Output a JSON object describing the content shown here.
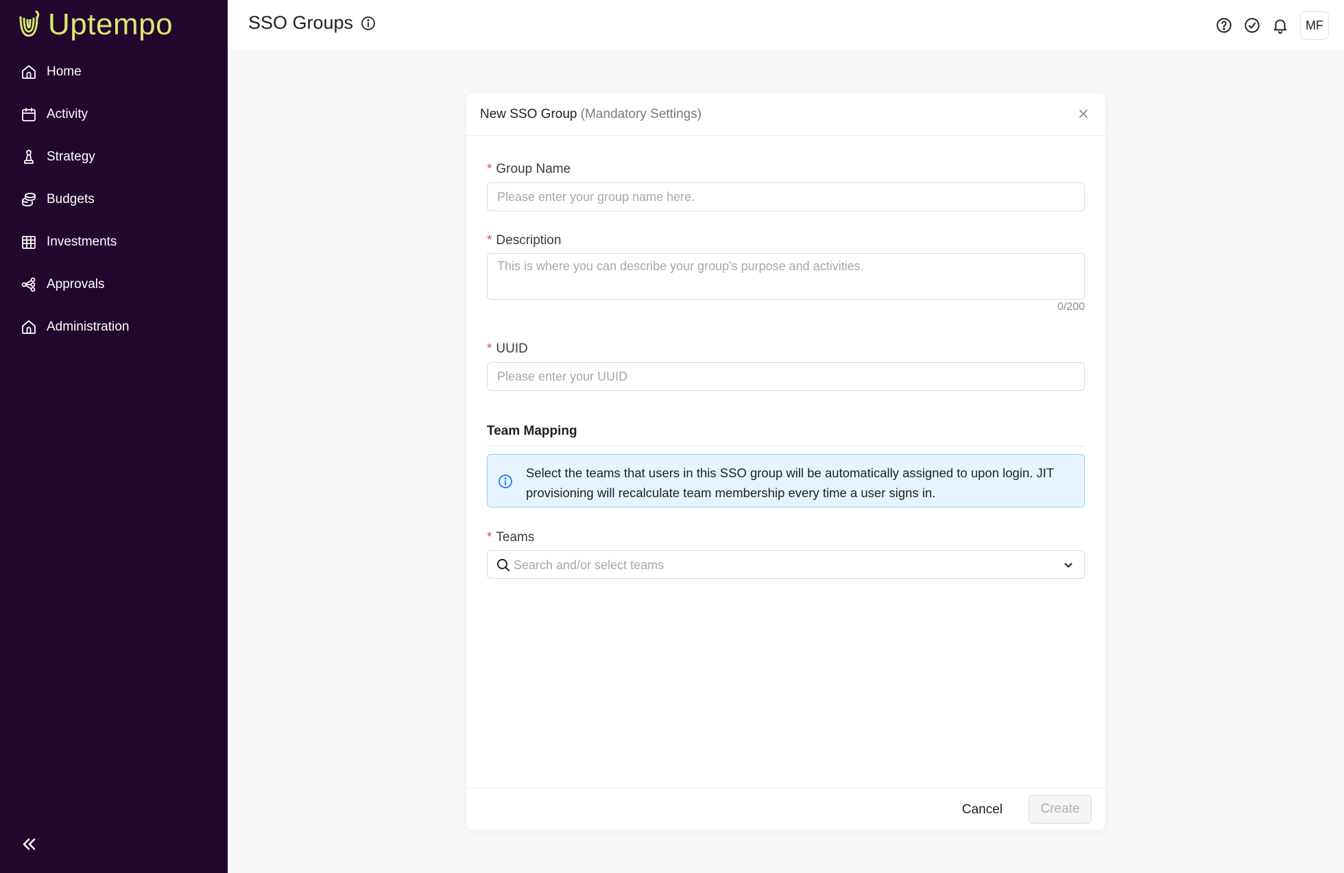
{
  "app": {
    "logo_text": "Uptempo",
    "brand_color": "#d6ea6f",
    "sidebar_bg": "#22082f"
  },
  "sidebar": {
    "items": [
      {
        "label": "Home",
        "icon": "home-icon"
      },
      {
        "label": "Activity",
        "icon": "calendar-icon"
      },
      {
        "label": "Strategy",
        "icon": "chess-icon"
      },
      {
        "label": "Budgets",
        "icon": "coins-icon"
      },
      {
        "label": "Investments",
        "icon": "table-icon"
      },
      {
        "label": "Approvals",
        "icon": "share-icon"
      },
      {
        "label": "Administration",
        "icon": "home-icon"
      }
    ],
    "collapse_icon": "double-chevron-left-icon"
  },
  "header": {
    "title": "SSO Groups",
    "title_icon": "info-icon",
    "actions": [
      "help-icon",
      "check-circle-icon",
      "bell-icon"
    ],
    "avatar_initials": "MF"
  },
  "modal": {
    "title": "New SSO Group",
    "subtitle": "(Mandatory Settings)",
    "close_icon": "close-icon",
    "group_name": {
      "label": "Group Name",
      "required_mark": "*",
      "placeholder": "Please enter your group name here.",
      "value": ""
    },
    "description": {
      "label": "Description",
      "required_mark": "*",
      "placeholder": "This is where you can describe your group's purpose and activities.",
      "value": "",
      "counter": "0/200"
    },
    "uuid": {
      "label": "UUID",
      "required_mark": "*",
      "placeholder": "Please enter your UUID",
      "value": ""
    },
    "team_mapping": {
      "title": "Team Mapping",
      "info_text": "Select the teams that users in this SSO group will be automatically assigned to upon login. JIT provisioning will recalculate team membership every time a user signs in.",
      "info_color": "#1677ff"
    },
    "teams": {
      "label": "Teams",
      "required_mark": "*",
      "placeholder": "Search and/or select teams"
    },
    "footer": {
      "cancel_label": "Cancel",
      "create_label": "Create"
    }
  }
}
